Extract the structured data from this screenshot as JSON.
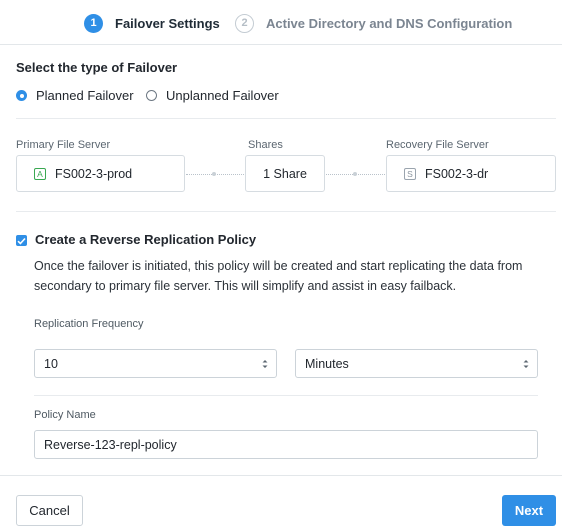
{
  "wizard": {
    "steps": [
      {
        "number": "1",
        "label": "Failover Settings",
        "state": "active"
      },
      {
        "number": "2",
        "label": "Active Directory and DNS Configuration",
        "state": "inactive"
      }
    ]
  },
  "failover_type": {
    "title": "Select the type of Failover",
    "options": [
      {
        "label": "Planned Failover",
        "selected": true
      },
      {
        "label": "Unplanned Failover",
        "selected": false
      }
    ]
  },
  "servers": {
    "primary": {
      "label": "Primary File Server",
      "name": "FS002-3-prod",
      "icon": "A"
    },
    "shares": {
      "label": "Shares",
      "value": "1 Share"
    },
    "recovery": {
      "label": "Recovery File Server",
      "name": "FS002-3-dr",
      "icon": "S"
    }
  },
  "reverse_policy": {
    "checkbox_label": "Create a Reverse Replication Policy",
    "checked": true,
    "description": "Once the failover is initiated, this policy will be created and start replicating the data from secondary to primary file server. This will simplify and assist in easy failback.",
    "frequency_label": "Replication Frequency",
    "frequency_value": "10",
    "frequency_unit": "Minutes",
    "policy_name_label": "Policy Name",
    "policy_name_value": "Reverse-123-repl-policy"
  },
  "footer": {
    "cancel_label": "Cancel",
    "next_label": "Next"
  },
  "colors": {
    "accent": "#2f8fe6",
    "active_icon": "#39a851"
  }
}
